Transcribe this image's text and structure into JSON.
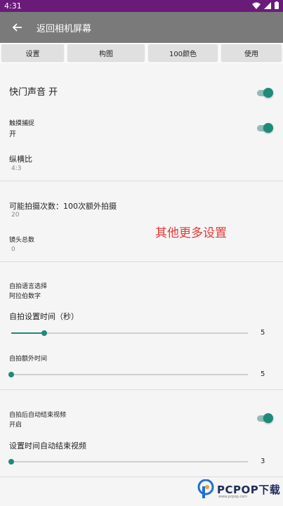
{
  "status_bar": {
    "time": "4:31"
  },
  "app_bar": {
    "title": "返回相机屏幕"
  },
  "tabs": [
    "设置",
    "构图",
    "100颜色",
    "使用"
  ],
  "settings": {
    "shutter_sound": "快门声音 开",
    "touch_capture": {
      "label": "触摸捕捉",
      "value": "开"
    },
    "aspect_ratio": {
      "label": "纵横比",
      "value": "4:3"
    },
    "shots": {
      "label": "可能拍摄次数：100次额外拍摄",
      "value": "20"
    },
    "lens_total": {
      "label": "镜头总数",
      "value": "0"
    },
    "selfie_language": {
      "label": "自拍语言选择",
      "value": "阿拉伯数字"
    },
    "selfie_timer": {
      "label": "自拍设置时间（秒）",
      "value": "5",
      "fraction": 0.14
    },
    "selfie_extra_time": {
      "label": "自拍额外时间",
      "value": "5",
      "fraction": 0.0
    },
    "selfie_end_video": {
      "label": "自拍后自动结束视频",
      "value": "开启"
    },
    "timer_end_video": {
      "label": "设置时间自动结束视频",
      "value": "3",
      "fraction": 0.0
    }
  },
  "annotation": "其他更多设置",
  "watermark": {
    "brand": "PCPOP下载",
    "sub": "www.pcpop.com"
  },
  "colors": {
    "status_bar": "#6a1b7a",
    "app_bar": "#7a7a7a",
    "accent": "#1e8a7a",
    "annotation": "#e53935"
  },
  "icons": [
    "wifi-icon",
    "signal-icon",
    "battery-icon",
    "back-arrow-icon"
  ]
}
